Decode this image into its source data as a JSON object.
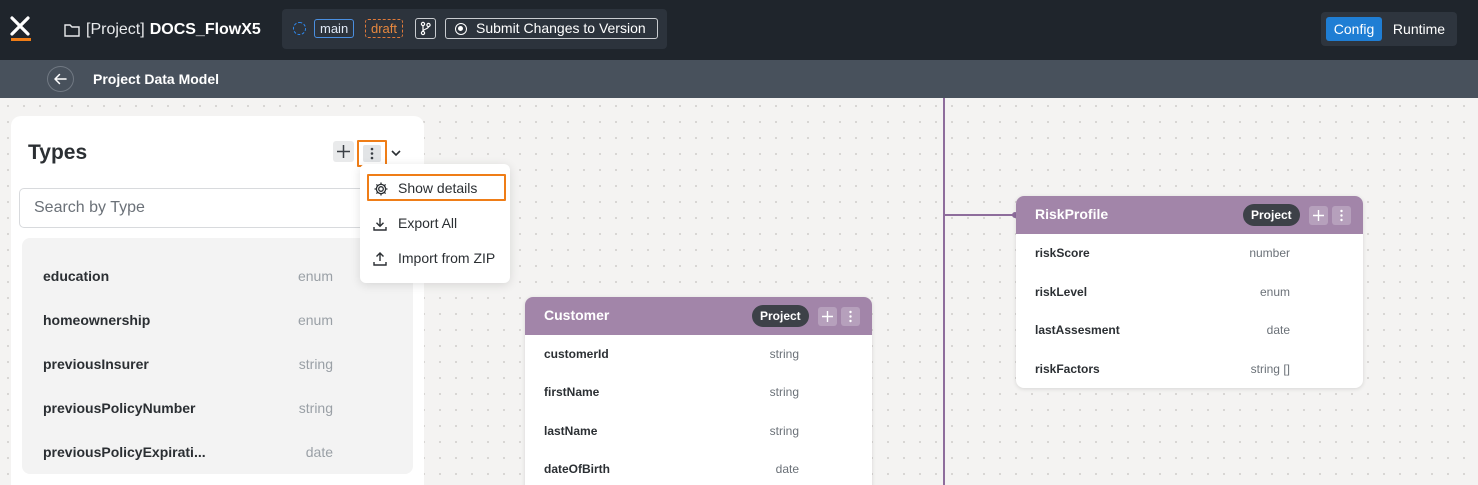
{
  "header": {
    "project_prefix": "[Project]",
    "project_name": "DOCS_FlowX5",
    "branch": "main",
    "status": "draft",
    "submit_label": "Submit Changes to Version",
    "mode_active": "Config",
    "mode_inactive": "Runtime"
  },
  "subheader": {
    "title": "Project Data Model"
  },
  "types_panel": {
    "title": "Types",
    "search_placeholder": "Search by Type",
    "items": [
      {
        "name": "education",
        "type": "enum"
      },
      {
        "name": "homeownership",
        "type": "enum"
      },
      {
        "name": "previousInsurer",
        "type": "string"
      },
      {
        "name": "previousPolicyNumber",
        "type": "string"
      },
      {
        "name": "previousPolicyExpirati...",
        "type": "date"
      }
    ]
  },
  "menu": {
    "items": [
      {
        "label": "Show details",
        "icon": "gear-icon"
      },
      {
        "label": "Export All",
        "icon": "download-icon"
      },
      {
        "label": "Import from ZIP",
        "icon": "upload-icon"
      }
    ]
  },
  "cards": {
    "customer": {
      "title": "Customer",
      "badge": "Project",
      "fields": [
        {
          "name": "customerId",
          "type": "string"
        },
        {
          "name": "firstName",
          "type": "string"
        },
        {
          "name": "lastName",
          "type": "string"
        },
        {
          "name": "dateOfBirth",
          "type": "date"
        }
      ]
    },
    "risk_profile": {
      "title": "RiskProfile",
      "badge": "Project",
      "fields": [
        {
          "name": "riskScore",
          "type": "number"
        },
        {
          "name": "riskLevel",
          "type": "enum"
        },
        {
          "name": "lastAssesment",
          "type": "date"
        },
        {
          "name": "riskFactors",
          "type": "string []"
        }
      ]
    }
  },
  "colors": {
    "accent_blue": "#1f7ed4",
    "highlight_orange": "#ef7d17",
    "card_header": "#a285a9",
    "topbar": "#1f252c"
  }
}
